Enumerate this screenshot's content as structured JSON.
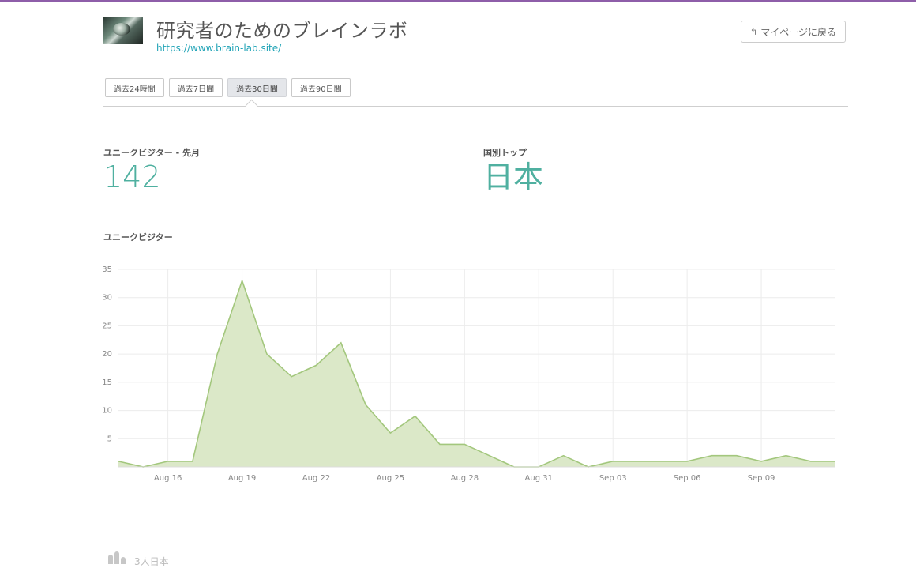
{
  "header": {
    "site_title": "研究者のためのブレインラボ",
    "site_url": "https://www.brain-lab.site/",
    "back_label": "マイページに戻る"
  },
  "tabs": [
    {
      "label": "過去24時間",
      "active": false
    },
    {
      "label": "過去7日間",
      "active": false
    },
    {
      "label": "過去30日間",
      "active": true
    },
    {
      "label": "過去90日間",
      "active": false
    }
  ],
  "stats": {
    "visitors_label": "ユニークビジター - 先月",
    "visitors_value": "142",
    "country_label": "国別トップ",
    "country_value": "日本"
  },
  "chart_title": "ユニークビジター",
  "bottom": {
    "text": "3人日本"
  },
  "colors": {
    "accent": "#4fb0a0",
    "area_fill": "#dbe8c8",
    "area_line": "#a3c77d",
    "link": "#1fa3b6",
    "top_bar": "#8e5ea9"
  },
  "chart_data": {
    "type": "area",
    "x": [
      "Aug 14",
      "Aug 15",
      "Aug 16",
      "Aug 17",
      "Aug 18",
      "Aug 19",
      "Aug 20",
      "Aug 21",
      "Aug 22",
      "Aug 23",
      "Aug 24",
      "Aug 25",
      "Aug 26",
      "Aug 27",
      "Aug 28",
      "Aug 29",
      "Aug 30",
      "Aug 31",
      "Sep 01",
      "Sep 02",
      "Sep 03",
      "Sep 04",
      "Sep 05",
      "Sep 06",
      "Sep 07",
      "Sep 08",
      "Sep 09",
      "Sep 10",
      "Sep 11"
    ],
    "series": [
      {
        "values": [
          1,
          0,
          1,
          1,
          20,
          33,
          20,
          16,
          18,
          22,
          11,
          6,
          9,
          4,
          4,
          2,
          0,
          0,
          2,
          0,
          1,
          1,
          1,
          1,
          2,
          2,
          1,
          2,
          1,
          1
        ]
      }
    ],
    "xticks": [
      "Aug 16",
      "Aug 19",
      "Aug 22",
      "Aug 25",
      "Aug 28",
      "Aug 31",
      "Sep 03",
      "Sep 06",
      "Sep 09"
    ],
    "yticks": [
      5,
      10,
      15,
      20,
      25,
      30,
      35
    ],
    "ylim": [
      0,
      35
    ],
    "grid": true,
    "title": "",
    "xlabel": "",
    "ylabel": ""
  }
}
